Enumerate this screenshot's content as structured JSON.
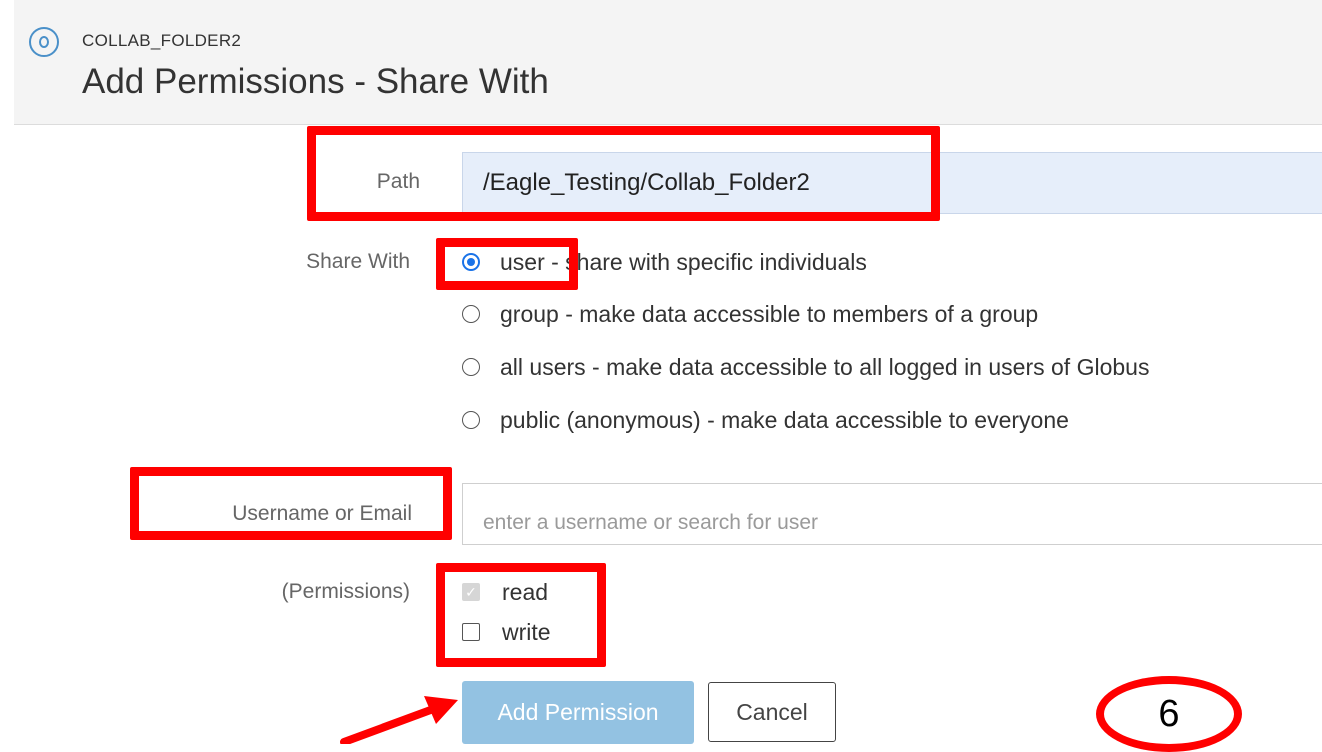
{
  "header": {
    "collection_name": "COLLAB_FOLDER2",
    "page_title": "Add Permissions - Share With",
    "icon": "collection-icon"
  },
  "form": {
    "path_label": "Path",
    "path_value": "/Eagle_Testing/Collab_Folder2",
    "share_with_label": "Share With",
    "share_options": [
      {
        "label": "user - share with specific individuals",
        "selected": true
      },
      {
        "label": "group - make data accessible to members of a group",
        "selected": false
      },
      {
        "label": "all users - make data accessible to all logged in users of Globus",
        "selected": false
      },
      {
        "label": "public (anonymous) - make data accessible to everyone",
        "selected": false
      }
    ],
    "username_label": "Username or Email",
    "username_placeholder": "enter a username or search for user",
    "permissions_label": "(Permissions)",
    "permissions": [
      {
        "label": "read",
        "checked": true,
        "disabled": true
      },
      {
        "label": "write",
        "checked": false,
        "disabled": false
      }
    ],
    "add_button": "Add Permission",
    "cancel_button": "Cancel"
  },
  "annotations": {
    "step_number": "6",
    "highlight_color": "#ff0000"
  },
  "colors": {
    "accent": "#1a73e8",
    "primary_button": "#93c2e2",
    "path_field_bg": "#e6eefa"
  }
}
